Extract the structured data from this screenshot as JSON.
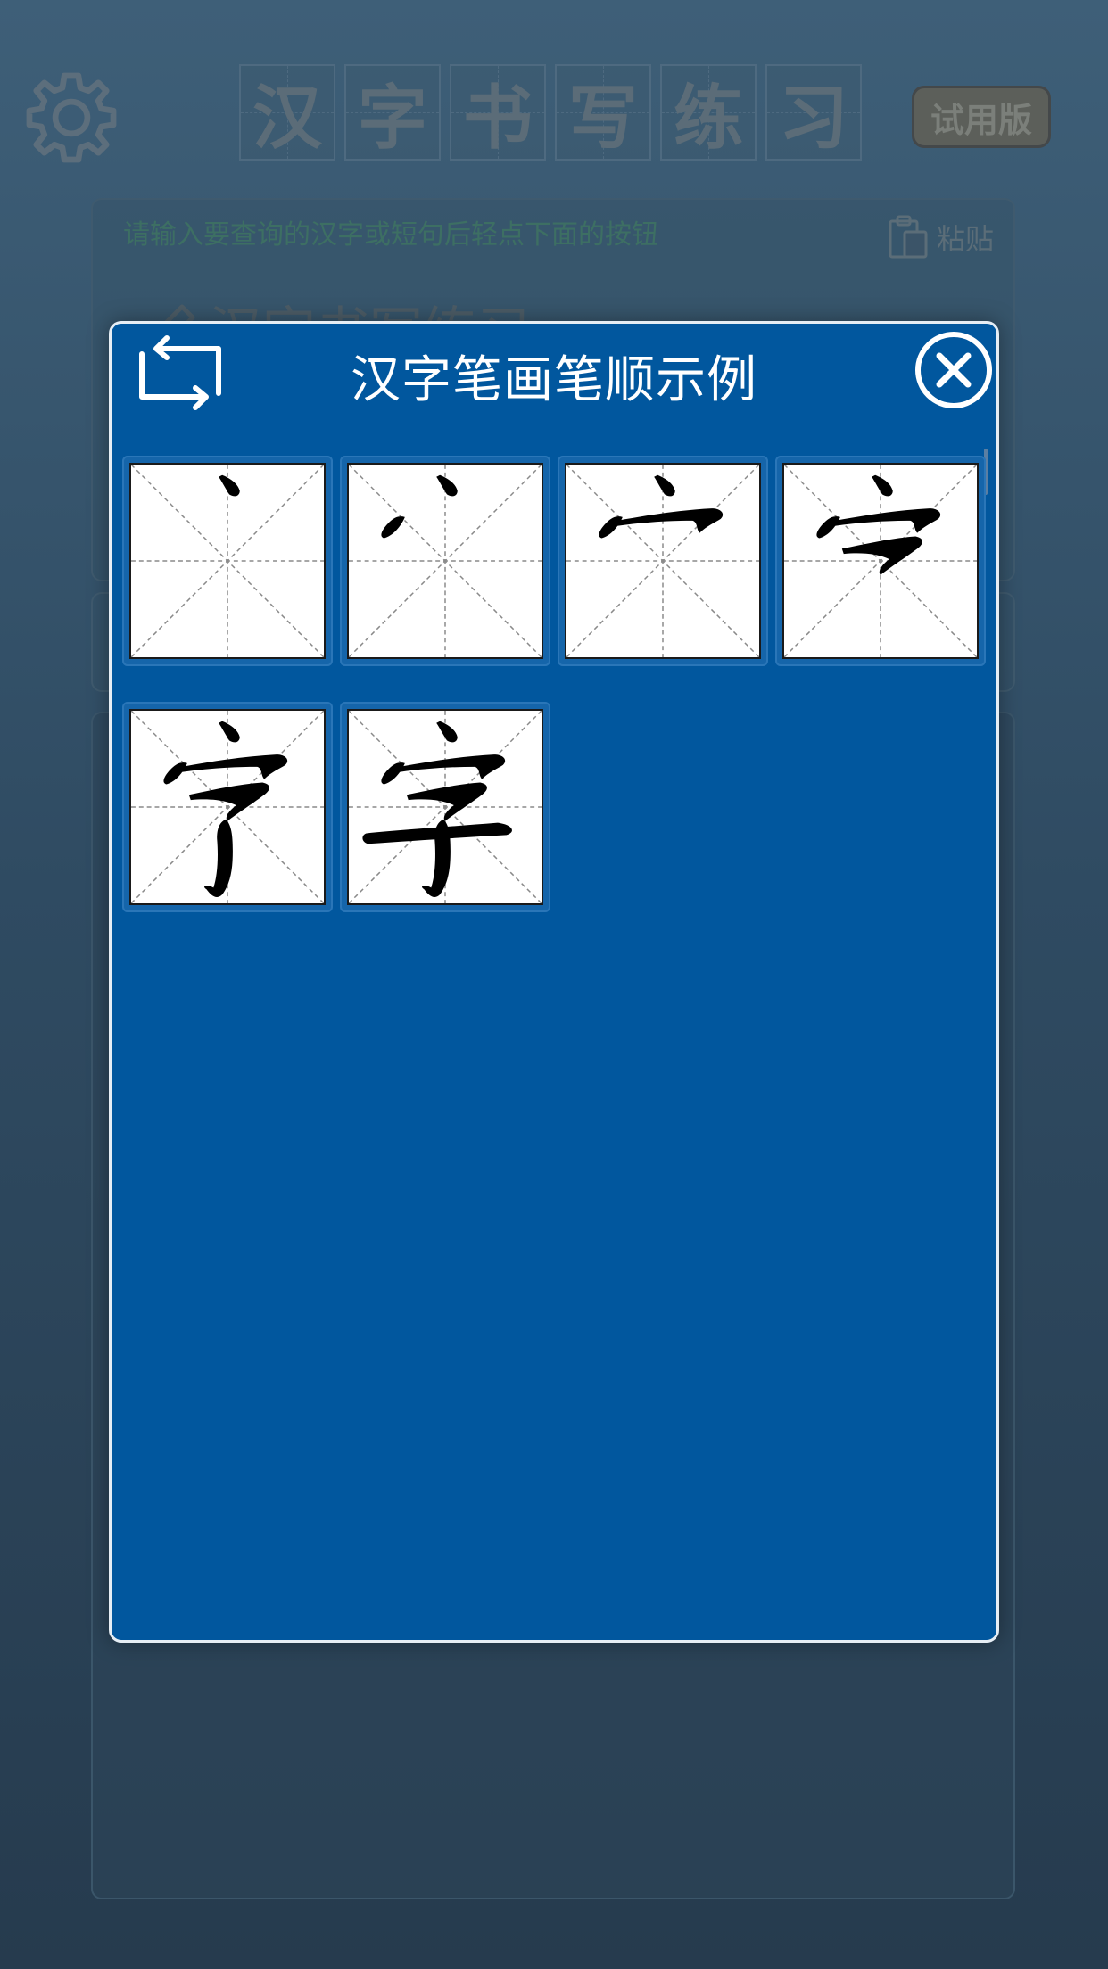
{
  "app": {
    "title_chars": [
      "汉",
      "字",
      "书",
      "写",
      "练",
      "习"
    ],
    "trial_badge": "试用版",
    "input_hint": "请输入要查询的汉字或短句后轻点下面的按钮",
    "paste_label": "粘贴",
    "input_value": "汉字书写练习"
  },
  "modal": {
    "title": "汉字笔画笔顺示例",
    "character": "字",
    "stroke_count": 6
  },
  "colors": {
    "modal_bg": "#01579e",
    "modal_border": "#e6eef5",
    "stroke_ink": "#000000",
    "guide_line": "#8a8a8a"
  },
  "icons": {
    "settings": "gear-icon",
    "repeat": "repeat-icon",
    "close": "close-icon",
    "paste": "clipboard-icon",
    "pen": "pen-icon"
  }
}
